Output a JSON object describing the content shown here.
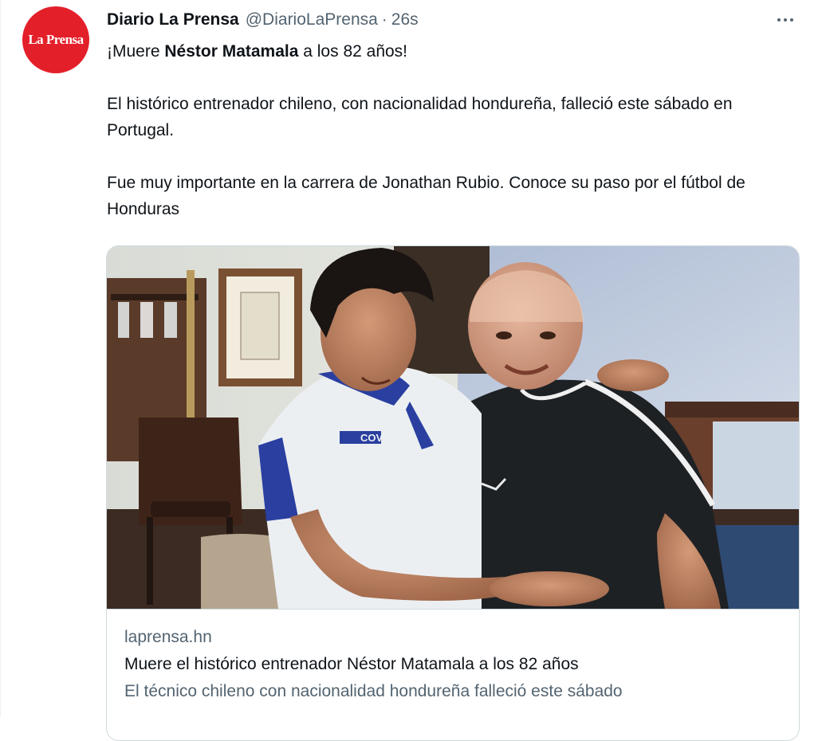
{
  "tweet": {
    "author": {
      "display_name": "Diario La Prensa",
      "handle": "@DiarioLaPrensa",
      "separator": "·",
      "time": "26s",
      "avatar_text": "La Prensa"
    },
    "text": {
      "line1_prefix": "¡Muere ",
      "line1_bold": "Néstor Matamala",
      "line1_suffix": " a los 82 años!",
      "paragraph2": "El histórico entrenador chileno, con nacionalidad hondureña, falleció este sábado en Portugal.",
      "paragraph3": "Fue muy importante en la carrera de Jonathan Rubio. Conoce su paso por el fútbol de Honduras"
    },
    "card": {
      "domain": "laprensa.hn",
      "title": "Muere el histórico entrenador Néstor Matamala a los 82 años",
      "description": "El técnico chileno con nacionalidad hondureña falleció este sábado",
      "jersey_text": "COVENSA"
    }
  },
  "colors": {
    "brand_red": "#e3202a",
    "text_primary": "#0f1419",
    "text_secondary": "#536471",
    "border": "#cfd9de"
  },
  "icons": {
    "more": "more-horizontal-icon"
  }
}
